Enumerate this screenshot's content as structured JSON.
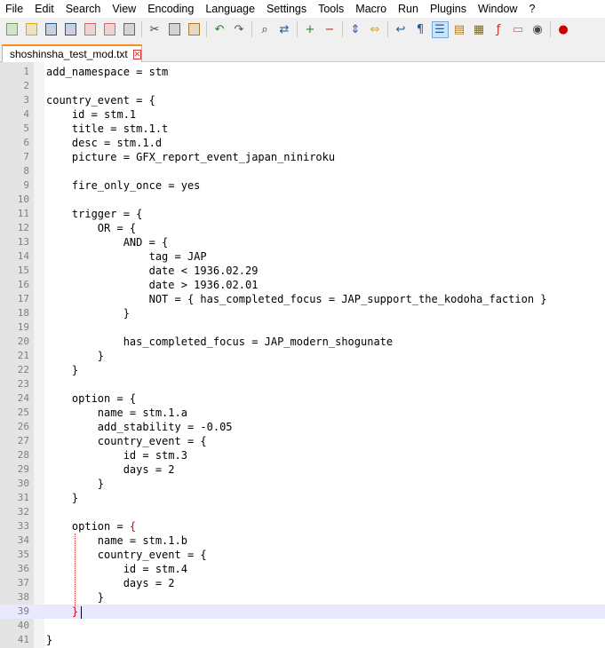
{
  "menu": [
    "File",
    "Edit",
    "Search",
    "View",
    "Encoding",
    "Language",
    "Settings",
    "Tools",
    "Macro",
    "Run",
    "Plugins",
    "Window",
    "?"
  ],
  "toolbar": {
    "groups": [
      [
        {
          "icon": "new-file-icon",
          "glyph": "",
          "color": "#6aa84f"
        },
        {
          "icon": "open-file-icon",
          "glyph": "",
          "color": "#e0a800"
        },
        {
          "icon": "save-icon",
          "glyph": "",
          "color": "#2b5797"
        },
        {
          "icon": "save-all-icon",
          "glyph": "",
          "color": "#2b5797"
        },
        {
          "icon": "close-file-icon",
          "glyph": "",
          "color": "#e06666"
        },
        {
          "icon": "close-all-icon",
          "glyph": "",
          "color": "#e06666"
        },
        {
          "icon": "print-icon",
          "glyph": "",
          "color": "#666666"
        }
      ],
      [
        {
          "icon": "cut-icon",
          "glyph": "✂",
          "color": "#444444"
        },
        {
          "icon": "copy-icon",
          "glyph": "",
          "color": "#666666"
        },
        {
          "icon": "paste-icon",
          "glyph": "",
          "color": "#b07a2a"
        }
      ],
      [
        {
          "icon": "undo-icon",
          "glyph": "↶",
          "color": "#2e7d32"
        },
        {
          "icon": "redo-icon",
          "glyph": "↷",
          "color": "#555555"
        }
      ],
      [
        {
          "icon": "find-icon",
          "glyph": "⌕",
          "color": "#333333"
        },
        {
          "icon": "replace-icon",
          "glyph": "⇄",
          "color": "#2b5797"
        }
      ],
      [
        {
          "icon": "zoom-in-icon",
          "glyph": "+",
          "color": "#2e7d32"
        },
        {
          "icon": "zoom-out-icon",
          "glyph": "−",
          "color": "#c62828"
        }
      ],
      [
        {
          "icon": "sync-vertical-icon",
          "glyph": "⇕",
          "color": "#2b5797"
        },
        {
          "icon": "sync-horizontal-icon",
          "glyph": "⇔",
          "color": "#e0a800"
        }
      ],
      [
        {
          "icon": "word-wrap-icon",
          "glyph": "↩",
          "color": "#2b5797"
        },
        {
          "icon": "show-all-chars-icon",
          "glyph": "¶",
          "color": "#2b5797"
        },
        {
          "icon": "indent-guide-icon",
          "glyph": "☰",
          "color": "#2b5797",
          "active": true
        },
        {
          "icon": "user-language-icon",
          "glyph": "▤",
          "color": "#b07a2a"
        },
        {
          "icon": "document-map-icon",
          "glyph": "▦",
          "color": "#7a6a2a"
        },
        {
          "icon": "function-list-icon",
          "glyph": "ƒ",
          "color": "#c62828"
        },
        {
          "icon": "folder-workspace-icon",
          "glyph": "▭",
          "color": "#e06666"
        },
        {
          "icon": "monitoring-icon",
          "glyph": "◉",
          "color": "#444444"
        }
      ],
      [
        {
          "icon": "record-macro-icon",
          "glyph": "●",
          "color": "#d00000"
        }
      ]
    ]
  },
  "tab": {
    "filename": "shoshinsha_test_mod.txt",
    "close_glyph": "✕"
  },
  "editor": {
    "current_line": 39,
    "lines": [
      "add_namespace = stm",
      "",
      "country_event = {",
      "    id = stm.1",
      "    title = stm.1.t",
      "    desc = stm.1.d",
      "    picture = GFX_report_event_japan_niniroku",
      "",
      "    fire_only_once = yes",
      "",
      "    trigger = {",
      "        OR = {",
      "            AND = {",
      "                tag = JAP",
      "                date < 1936.02.29",
      "                date > 1936.02.01",
      "                NOT = { has_completed_focus = JAP_support_the_kodoha_faction }",
      "            }",
      "",
      "            has_completed_focus = JAP_modern_shogunate",
      "        }",
      "    }",
      "",
      "    option = {",
      "        name = stm.1.a",
      "        add_stability = -0.05",
      "        country_event = {",
      "            id = stm.3",
      "            days = 2",
      "        }",
      "    }",
      "",
      "    option = {",
      "        name = stm.1.b",
      "        country_event = {",
      "            id = stm.4",
      "            days = 2",
      "        }",
      "    }",
      "",
      "}"
    ]
  }
}
